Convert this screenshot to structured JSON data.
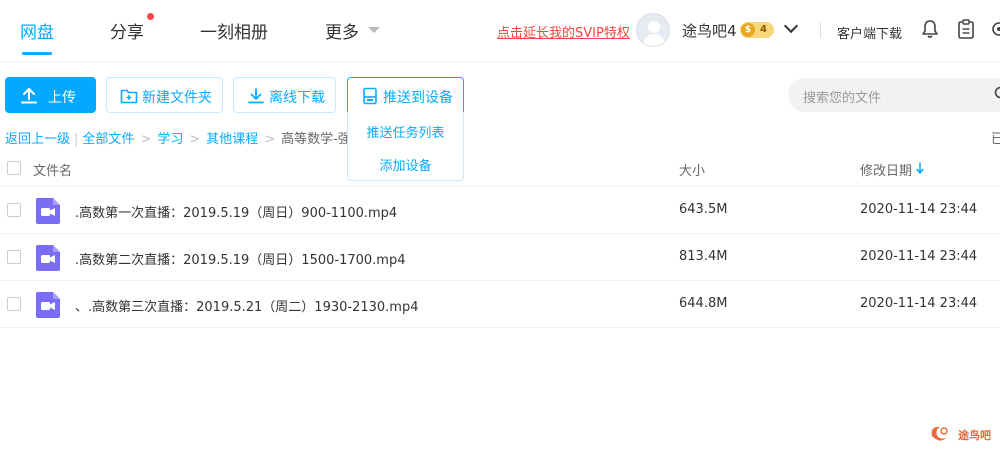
{
  "nav": {
    "tabs": [
      "网盘",
      "分享",
      "一刻相册",
      "更多"
    ],
    "svip_link": "点击延长我的SVIP特权",
    "username": "途鸟吧4",
    "vip_level": "4",
    "vip_coin": "$",
    "client_download": "客户端下载"
  },
  "toolbar": {
    "upload": "上传",
    "new_folder": "新建文件夹",
    "offline_download": "离线下载",
    "push_to_device": "推送到设备",
    "search_placeholder": "搜索您的文件"
  },
  "dropdown": {
    "items": [
      "推送任务列表",
      "添加设备"
    ]
  },
  "breadcrumb": {
    "back": "返回上一级",
    "all_files": "全部文件",
    "level1": "学习",
    "level2": "其他课程",
    "current": "高等数学-强化退",
    "right_edge": "已"
  },
  "table": {
    "headers": {
      "name": "文件名",
      "size": "大小",
      "date": "修改日期"
    },
    "rows": [
      {
        "name": ".高数第一次直播：2019.5.19（周日）900-1100.mp4",
        "size": "643.5M",
        "date": "2020-11-14 23:44"
      },
      {
        "name": ".高数第二次直播：2019.5.19（周日）1500-1700.mp4",
        "size": "813.4M",
        "date": "2020-11-14 23:44"
      },
      {
        "name": "、.高数第三次直播：2019.5.21（周二）1930-2130.mp4",
        "size": "644.8M",
        "date": "2020-11-14 23:44"
      }
    ]
  },
  "watermark": {
    "text": "途鸟吧"
  },
  "colors": {
    "accent": "#09aaff",
    "svip": "#f1473e",
    "video_icon": "#7b6cf6"
  }
}
